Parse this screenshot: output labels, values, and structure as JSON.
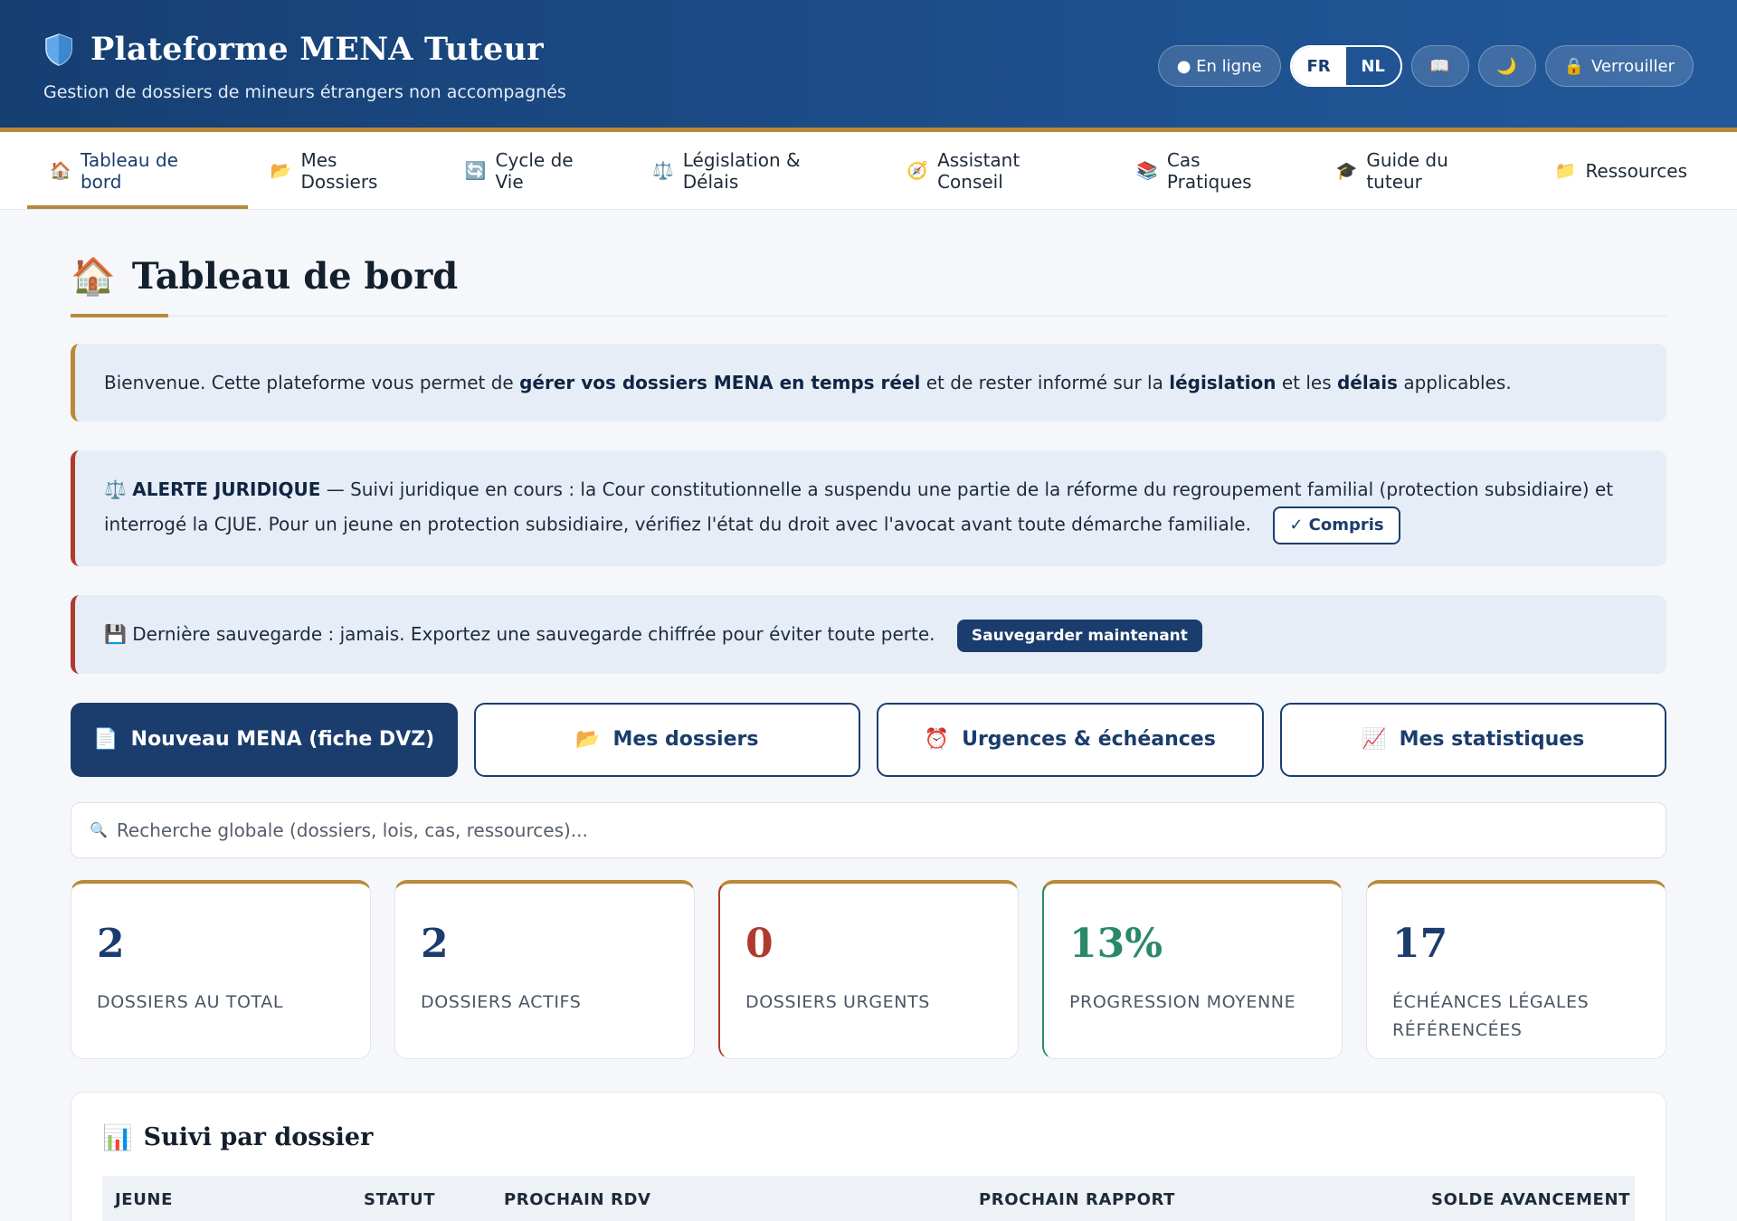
{
  "header": {
    "title": "Plateforme MENA Tuteur",
    "subtitle": "Gestion de dossiers de mineurs étrangers non accompagnés",
    "status": "● En ligne",
    "lang_fr": "FR",
    "lang_nl": "NL",
    "guide_icon": "📖",
    "theme_icon": "🌙",
    "lock_icon": "🔒",
    "lock_label": "Verrouiller"
  },
  "nav": [
    {
      "icon": "🏠",
      "label": "Tableau de bord"
    },
    {
      "icon": "📂",
      "label": "Mes Dossiers"
    },
    {
      "icon": "🔄",
      "label": "Cycle de Vie"
    },
    {
      "icon": "⚖️",
      "label": "Législation & Délais"
    },
    {
      "icon": "🧭",
      "label": "Assistant Conseil"
    },
    {
      "icon": "📚",
      "label": "Cas Pratiques"
    },
    {
      "icon": "🎓",
      "label": "Guide du tuteur"
    },
    {
      "icon": "📁",
      "label": "Ressources"
    }
  ],
  "page": {
    "title_icon": "🏠",
    "title": "Tableau de bord"
  },
  "welcome": {
    "p1": "Bienvenue. Cette plateforme vous permet de ",
    "b1": "gérer vos dossiers MENA en temps réel",
    "p2": " et de rester informé sur la ",
    "b2": "législation",
    "p3": " et les ",
    "b3": "délais",
    "p4": " applicables."
  },
  "alert": {
    "icon": "⚖️",
    "title": "ALERTE JURIDIQUE",
    "text": " — Suivi juridique en cours : la Cour constitutionnelle a suspendu une partie de la réforme du regroupement familial (protection subsidiaire) et interrogé la CJUE. Pour un jeune en protection subsidiaire, vérifiez l'état du droit avec l'avocat avant toute démarche familiale.",
    "button": "✓ Compris"
  },
  "backup": {
    "icon": "💾",
    "text": "Dernière sauvegarde : jamais. Exportez une sauvegarde chiffrée pour éviter toute perte.",
    "button": "Sauvegarder maintenant"
  },
  "actions": [
    {
      "icon": "📄",
      "label": "Nouveau MENA (fiche DVZ)"
    },
    {
      "icon": "📂",
      "label": "Mes dossiers"
    },
    {
      "icon": "⏰",
      "label": "Urgences & échéances"
    },
    {
      "icon": "📈",
      "label": "Mes statistiques"
    }
  ],
  "search": {
    "icon": "🔍",
    "placeholder": "Recherche globale (dossiers, lois, cas, ressources)..."
  },
  "stats": [
    {
      "value": "2",
      "label": "Dossiers au total"
    },
    {
      "value": "2",
      "label": "Dossiers actifs"
    },
    {
      "value": "0",
      "label": "Dossiers urgents"
    },
    {
      "value": "13%",
      "label": "Progression moyenne"
    },
    {
      "value": "17",
      "label": "Échéances légales référencées"
    }
  ],
  "tracking": {
    "icon": "📊",
    "title": "Suivi par dossier",
    "columns": [
      "Jeune",
      "Statut",
      "Prochain RDV",
      "Prochain rapport",
      "Solde",
      "Avancement"
    ]
  },
  "colors": {
    "primary": "#1a3d6d",
    "accent_gold": "#b8893a",
    "alert_red": "#b03a2e",
    "success_green": "#2a8a67"
  }
}
